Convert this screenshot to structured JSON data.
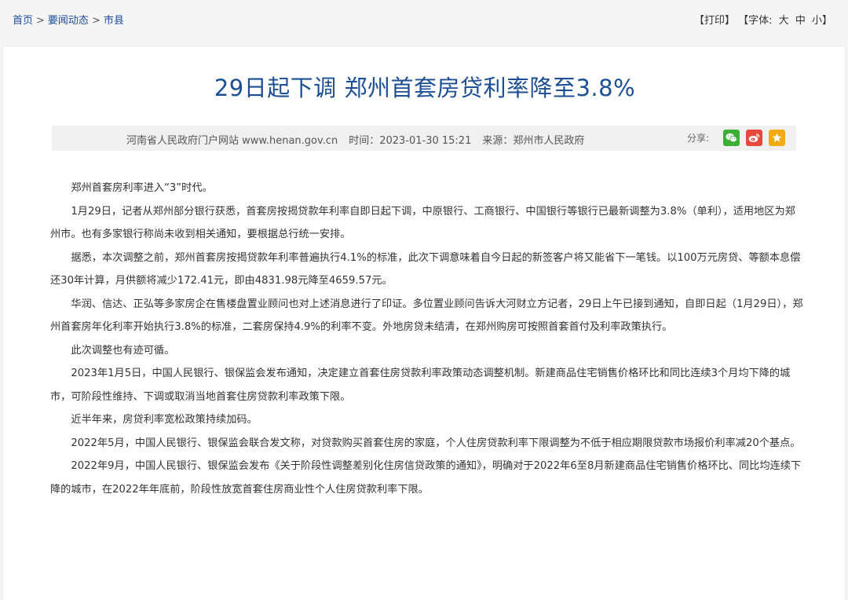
{
  "breadcrumb": {
    "home": "首页",
    "section": "要闻动态",
    "current": "市县",
    "separator": ">"
  },
  "tools": {
    "print": "【打印】",
    "font_prefix": "【字体:",
    "size_large": "大",
    "size_medium": "中",
    "size_small": "小",
    "font_suffix": "】"
  },
  "article": {
    "title": "29日起下调 郑州首套房贷利率降至3.8%",
    "site": "河南省人民政府门户网站 www.henan.gov.cn",
    "time": "时间：2023-01-30 15:21",
    "source": "来源：郑州市人民政府",
    "paragraphs": [
      "郑州首套房利率进入“3”时代。",
      "1月29日，记者从郑州部分银行获悉，首套房按揭贷款年利率自即日起下调，中原银行、工商银行、中国银行等银行已最新调整为3.8%（单利），适用地区为郑州市。也有多家银行称尚未收到相关通知，要根据总行统一安排。",
      "据悉，本次调整之前，郑州首套房按揭贷款年利率普遍执行4.1%的标准，此次下调意味着自今日起的新签客户将又能省下一笔钱。以100万元房贷、等额本息偿还30年计算，月供额将减少172.41元，即由4831.98元降至4659.57元。",
      "华润、信达、正弘等多家房企在售楼盘置业顾问也对上述消息进行了印证。多位置业顾问告诉大河财立方记者，29日上午已接到通知，自即日起（1月29日），郑州首套房年化利率开始执行3.8%的标准，二套房保持4.9%的利率不变。外地房贷未结清，在郑州购房可按照首套首付及利率政策执行。",
      "此次调整也有迹可循。",
      "2023年1月5日，中国人民银行、银保监会发布通知，决定建立首套住房贷款利率政策动态调整机制。新建商品住宅销售价格环比和同比连续3个月均下降的城市，可阶段性维持、下调或取消当地首套住房贷款利率政策下限。",
      "近半年来，房贷利率宽松政策持续加码。",
      "2022年5月，中国人民银行、银保监会联合发文称，对贷款购买首套住房的家庭，个人住房贷款利率下限调整为不低于相应期限贷款市场报价利率减20个基点。",
      "2022年9月，中国人民银行、银保监会发布《关于阶段性调整差别化住房信贷政策的通知》，明确对于2022年6至8月新建商品住宅销售价格环比、同比均连续下降的城市，在2022年年底前，阶段性放宽首套住房商业性个人住房贷款利率下限。"
    ]
  },
  "share": {
    "label": "分享:",
    "icons": [
      "wechat-icon",
      "weibo-icon",
      "favorite-icon"
    ],
    "colors": {
      "wechat": "#3cb034",
      "weibo": "#e8483b",
      "favorite": "#f2ab18"
    }
  },
  "colors": {
    "title": "#1c4f93",
    "link": "#1a4b9b"
  }
}
